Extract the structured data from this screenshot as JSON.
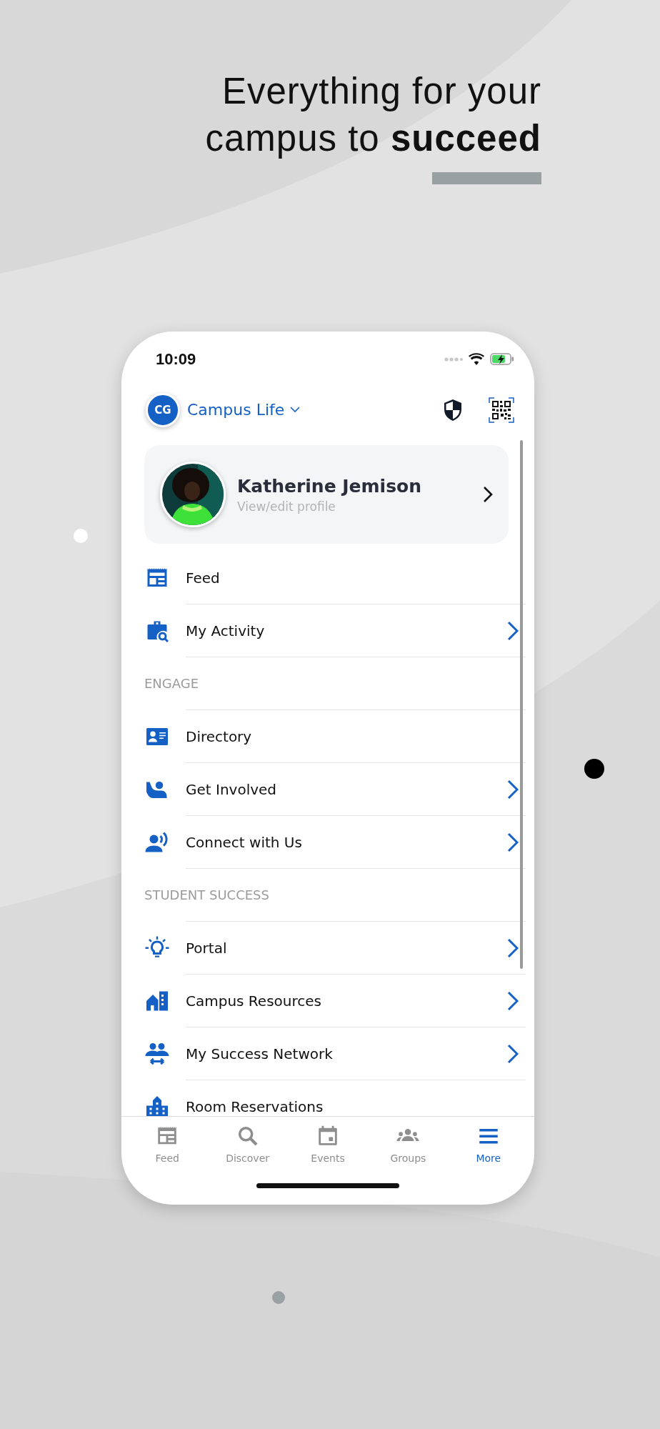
{
  "headline": "Everything for your campus to **succeed**",
  "status_bar": {
    "time": "10:09"
  },
  "header": {
    "logo_text": "CG",
    "campus": "Campus Life"
  },
  "profile": {
    "name": "Katherine Jemison",
    "subtitle": "View/edit profile"
  },
  "rows": [
    {
      "kind": "item",
      "label": "Feed",
      "chevron": false
    },
    {
      "kind": "item",
      "label": "My Activity",
      "chevron": true
    },
    {
      "kind": "section",
      "label": "ENGAGE"
    },
    {
      "kind": "item",
      "label": "Directory",
      "chevron": false
    },
    {
      "kind": "item",
      "label": "Get Involved",
      "chevron": true
    },
    {
      "kind": "item",
      "label": "Connect with Us",
      "chevron": true
    },
    {
      "kind": "section",
      "label": "STUDENT SUCCESS"
    },
    {
      "kind": "item",
      "label": "Portal",
      "chevron": true
    },
    {
      "kind": "item",
      "label": "Campus Resources",
      "chevron": true
    },
    {
      "kind": "item",
      "label": "My Success Network",
      "chevron": true
    },
    {
      "kind": "item",
      "label": "Room Reservations",
      "chevron": false
    }
  ],
  "tabs": [
    {
      "label": "Feed",
      "selected": false
    },
    {
      "label": "Discover",
      "selected": false
    },
    {
      "label": "Events",
      "selected": false
    },
    {
      "label": "Groups",
      "selected": false
    },
    {
      "label": "More",
      "selected": true
    }
  ]
}
